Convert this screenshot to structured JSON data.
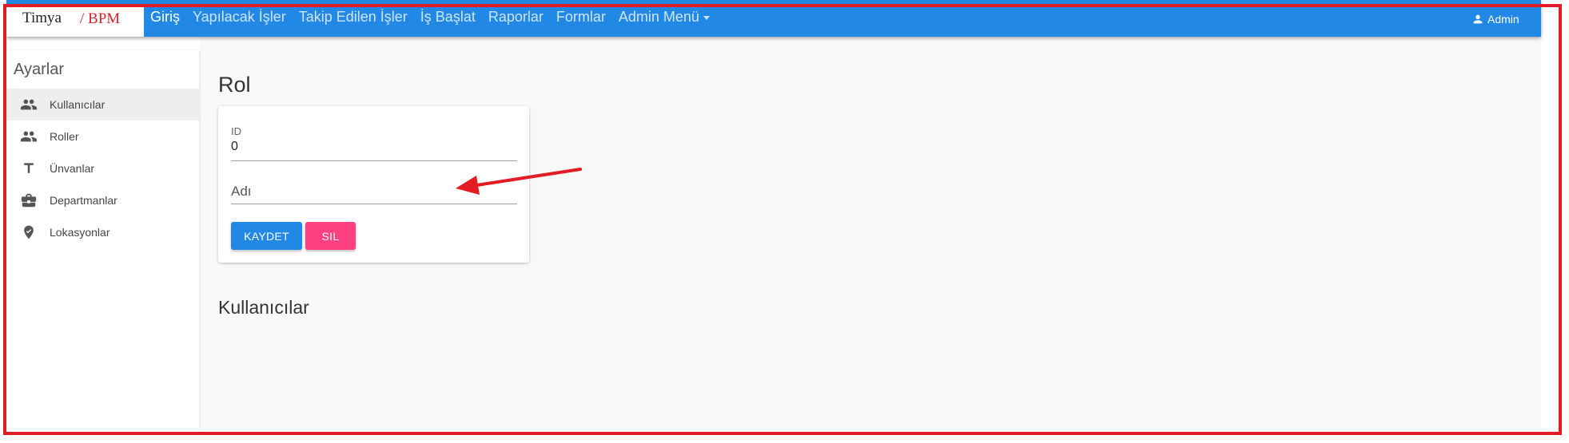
{
  "brand": {
    "part1": "Timya",
    "part2": "/ BPM"
  },
  "nav": {
    "items": [
      {
        "label": "Giriş",
        "active": true
      },
      {
        "label": "Yapılacak İşler",
        "active": false
      },
      {
        "label": "Takip Edilen İşler",
        "active": false
      },
      {
        "label": "İş Başlat",
        "active": false
      },
      {
        "label": "Raporlar",
        "active": false
      },
      {
        "label": "Formlar",
        "active": false
      },
      {
        "label": "Admin Menü",
        "active": false,
        "dropdown": true
      }
    ],
    "user_label": "Admin",
    "bar_color": "#2189e5"
  },
  "sidebar": {
    "title": "Ayarlar",
    "items": [
      {
        "label": "Kullanıcılar",
        "icon": "people-icon",
        "selected": true
      },
      {
        "label": "Roller",
        "icon": "people-icon",
        "selected": false
      },
      {
        "label": "Ünvanlar",
        "icon": "title-icon",
        "selected": false
      },
      {
        "label": "Departmanlar",
        "icon": "briefcase-icon",
        "selected": false
      },
      {
        "label": "Lokasyonlar",
        "icon": "location-icon",
        "selected": false
      }
    ]
  },
  "main": {
    "title": "Rol",
    "form": {
      "id_label": "ID",
      "id_value": "0",
      "name_placeholder": "Adı",
      "name_value": "",
      "save_label": "KAYDET",
      "delete_label": "SIL"
    },
    "section_title": "Kullanıcılar"
  },
  "colors": {
    "primary": "#2189e5",
    "accent": "#ff4081",
    "annotation": "#e21c22"
  }
}
